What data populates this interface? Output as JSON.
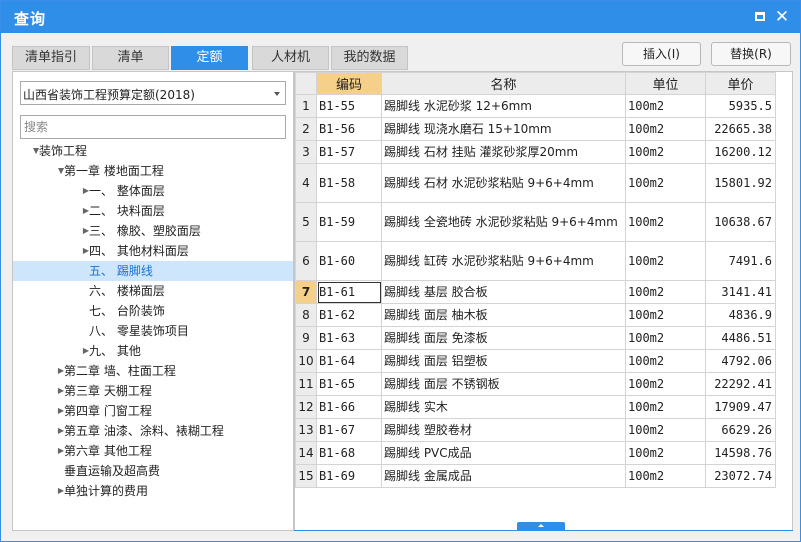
{
  "window": {
    "title": "查询"
  },
  "tabs": [
    {
      "label": "清单指引",
      "active": false
    },
    {
      "label": "清单",
      "active": false
    },
    {
      "label": "定额",
      "active": true
    },
    {
      "label": "人材机",
      "active": false
    },
    {
      "label": "我的数据",
      "active": false
    }
  ],
  "actions": {
    "insert_label": "插入(I)",
    "replace_label": "替换(R)"
  },
  "left": {
    "quota_library": "山西省装饰工程预算定额(2018)",
    "search_placeholder": "搜索",
    "tree": [
      {
        "label": "装饰工程",
        "level": 0,
        "caret": "▲",
        "selected": false
      },
      {
        "label": "第一章  楼地面工程",
        "level": 1,
        "caret": "▲",
        "selected": false
      },
      {
        "label": "一、 整体面层",
        "level": 2,
        "caret": "▶",
        "selected": false
      },
      {
        "label": "二、 块料面层",
        "level": 2,
        "caret": "▶",
        "selected": false
      },
      {
        "label": "三、 橡胶、塑胶面层",
        "level": 2,
        "caret": "▶",
        "selected": false
      },
      {
        "label": "四、 其他材料面层",
        "level": 2,
        "caret": "▶",
        "selected": false
      },
      {
        "label": "五、 踢脚线",
        "level": 2,
        "caret": "",
        "selected": true
      },
      {
        "label": "六、 楼梯面层",
        "level": 2,
        "caret": "",
        "selected": false
      },
      {
        "label": "七、 台阶装饰",
        "level": 2,
        "caret": "",
        "selected": false
      },
      {
        "label": "八、 零星装饰项目",
        "level": 2,
        "caret": "",
        "selected": false
      },
      {
        "label": "九、 其他",
        "level": 2,
        "caret": "▶",
        "selected": false
      },
      {
        "label": "第二章 墙、柱面工程",
        "level": 1,
        "caret": "▶",
        "selected": false
      },
      {
        "label": "第三章 天棚工程",
        "level": 1,
        "caret": "▶",
        "selected": false
      },
      {
        "label": "第四章 门窗工程",
        "level": 1,
        "caret": "▶",
        "selected": false
      },
      {
        "label": "第五章 油漆、涂料、裱糊工程",
        "level": 1,
        "caret": "▶",
        "selected": false
      },
      {
        "label": "第六章 其他工程",
        "level": 1,
        "caret": "▶",
        "selected": false
      },
      {
        "label": "垂直运输及超高费",
        "level": 1,
        "caret": "",
        "selected": false
      },
      {
        "label": "单独计算的费用",
        "level": 1,
        "caret": "▶",
        "selected": false
      }
    ]
  },
  "table": {
    "headers": {
      "code": "编码",
      "name": "名称",
      "unit": "单位",
      "price": "单价"
    },
    "rows": [
      {
        "idx": "1",
        "code": "B1-55",
        "name": "踢脚线 水泥砂浆 12+6mm",
        "unit": "100m2",
        "price": "5935.5",
        "tall": false
      },
      {
        "idx": "2",
        "code": "B1-56",
        "name": "踢脚线 现浇水磨石 15+10mm",
        "unit": "100m2",
        "price": "22665.38",
        "tall": false
      },
      {
        "idx": "3",
        "code": "B1-57",
        "name": "踢脚线 石材 挂贴 灌浆砂浆厚20mm",
        "unit": "100m2",
        "price": "16200.12",
        "tall": false
      },
      {
        "idx": "4",
        "code": "B1-58",
        "name": "踢脚线 石材 水泥砂浆粘贴 9+6+4mm",
        "unit": "100m2",
        "price": "15801.92",
        "tall": true
      },
      {
        "idx": "5",
        "code": "B1-59",
        "name": "踢脚线 全瓷地砖 水泥砂浆粘贴 9+6+4mm",
        "unit": "100m2",
        "price": "10638.67",
        "tall": true
      },
      {
        "idx": "6",
        "code": "B1-60",
        "name": "踢脚线 缸砖 水泥砂浆粘贴 9+6+4mm",
        "unit": "100m2",
        "price": "7491.6",
        "tall": true
      },
      {
        "idx": "7",
        "code": "B1-61",
        "name": "踢脚线 基层 胶合板",
        "unit": "100m2",
        "price": "3141.41",
        "tall": false,
        "active": true
      },
      {
        "idx": "8",
        "code": "B1-62",
        "name": "踢脚线 面层 柚木板",
        "unit": "100m2",
        "price": "4836.9",
        "tall": false
      },
      {
        "idx": "9",
        "code": "B1-63",
        "name": "踢脚线 面层 免漆板",
        "unit": "100m2",
        "price": "4486.51",
        "tall": false
      },
      {
        "idx": "10",
        "code": "B1-64",
        "name": "踢脚线 面层 铝塑板",
        "unit": "100m2",
        "price": "4792.06",
        "tall": false
      },
      {
        "idx": "11",
        "code": "B1-65",
        "name": "踢脚线 面层 不锈钢板",
        "unit": "100m2",
        "price": "22292.41",
        "tall": false
      },
      {
        "idx": "12",
        "code": "B1-66",
        "name": "踢脚线 实木",
        "unit": "100m2",
        "price": "17909.47",
        "tall": false
      },
      {
        "idx": "13",
        "code": "B1-67",
        "name": "踢脚线 塑胶卷材",
        "unit": "100m2",
        "price": "6629.26",
        "tall": false
      },
      {
        "idx": "14",
        "code": "B1-68",
        "name": "踢脚线 PVC成品",
        "unit": "100m2",
        "price": "14598.76",
        "tall": false
      },
      {
        "idx": "15",
        "code": "B1-69",
        "name": "踢脚线 金属成品",
        "unit": "100m2",
        "price": "23072.74",
        "tall": false
      }
    ]
  }
}
